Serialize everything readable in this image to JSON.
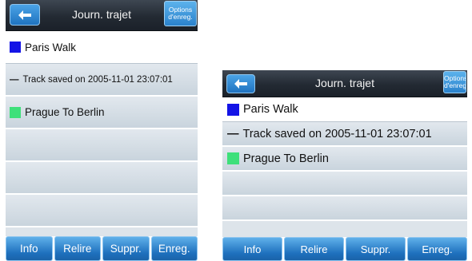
{
  "screens": [
    {
      "header": {
        "title": "Journ. trajet",
        "options_line1": "Options",
        "options_line2": "d'enreg."
      },
      "rows": [
        {
          "type": "swatch",
          "color": "#1414e6",
          "label": "Paris Walk",
          "selected": true
        },
        {
          "type": "dash",
          "dash": "—",
          "label": "Track saved on 2005-11-01 23:07:01",
          "selected": false
        },
        {
          "type": "swatch",
          "color": "#3ee07a",
          "label": "Prague To Berlin",
          "selected": false
        }
      ],
      "buttons": [
        "Info",
        "Relire",
        "Suppr.",
        "Enreg."
      ]
    },
    {
      "header": {
        "title": "Journ. trajet",
        "options_line1": "Options",
        "options_line2": "d'enreg."
      },
      "rows": [
        {
          "type": "swatch",
          "color": "#1414e6",
          "label": "Paris Walk",
          "selected": true
        },
        {
          "type": "dash",
          "dash": "—",
          "label": "Track saved on 2005-11-01 23:07:01",
          "selected": false
        },
        {
          "type": "swatch",
          "color": "#3ee07a",
          "label": "Prague To Berlin",
          "selected": false
        }
      ],
      "buttons": [
        "Info",
        "Relire",
        "Suppr.",
        "Enreg."
      ]
    }
  ]
}
